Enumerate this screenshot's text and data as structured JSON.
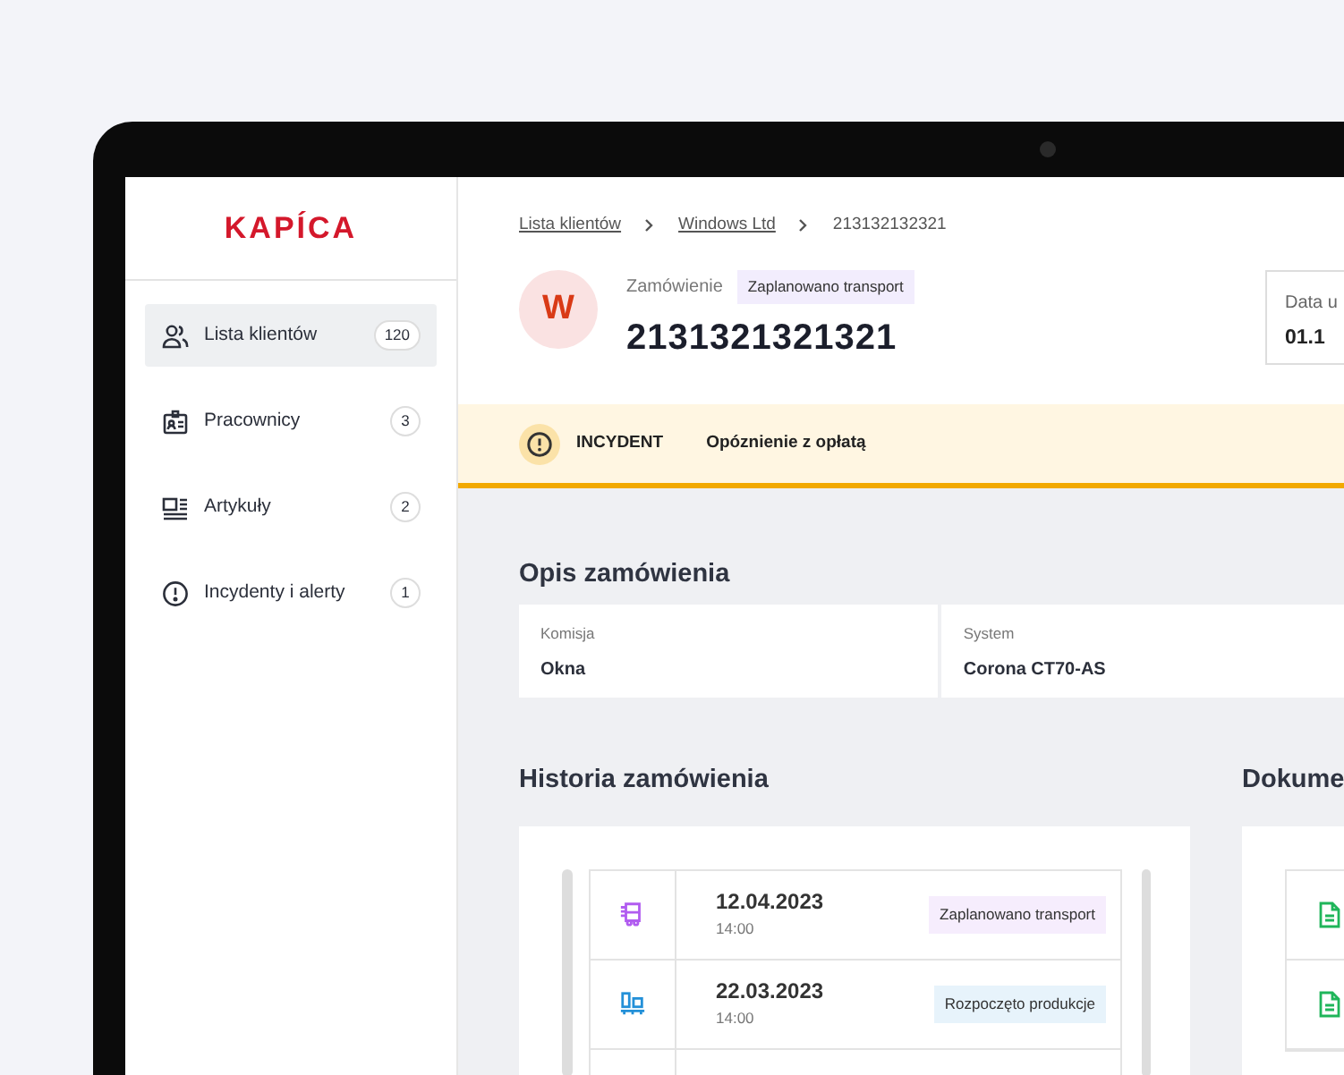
{
  "logo": "KAPÍCA",
  "sidebar": {
    "items": [
      {
        "kind": "users",
        "label": "Lista klientów",
        "count": "120",
        "selected": true
      },
      {
        "kind": "badge",
        "label": "Pracownicy",
        "count": "3",
        "selected": false
      },
      {
        "kind": "article",
        "label": "Artykuły",
        "count": "2",
        "selected": false
      },
      {
        "kind": "alert",
        "label": "Incydenty i alerty",
        "count": "1",
        "selected": false
      }
    ]
  },
  "breadcrumb": [
    {
      "kind": "link",
      "label": "Lista klientów"
    },
    {
      "kind": "link",
      "label": "Windows Ltd"
    },
    {
      "kind": "current",
      "label": "213132132321"
    }
  ],
  "order": {
    "avatar": "W",
    "type_label": "Zamówienie",
    "status": "Zaplanowano transport",
    "number": "2131321321321"
  },
  "date_box": {
    "label": "Data u",
    "value": "01.1"
  },
  "incident": {
    "tag": "INCYDENT",
    "text": "Opóznienie z opłatą"
  },
  "description": {
    "title": "Opis zamówienia",
    "fields": [
      {
        "label": "Komisja",
        "value": "Okna"
      },
      {
        "label": "System",
        "value": "Corona CT70-AS"
      }
    ]
  },
  "history": {
    "title": "Historia zamówienia",
    "entries": [
      {
        "kind": "transport",
        "date": "12.04.2023",
        "time": "14:00",
        "status": "Zaplanowano transport",
        "color": "#b15cf0"
      },
      {
        "kind": "production",
        "date": "22.03.2023",
        "time": "14:00",
        "status": "Rozpoczęto produkcje",
        "color": "#2390d8"
      }
    ]
  },
  "documents": {
    "title": "Dokume",
    "items": [
      {
        "kind": "file"
      },
      {
        "kind": "file"
      }
    ]
  }
}
